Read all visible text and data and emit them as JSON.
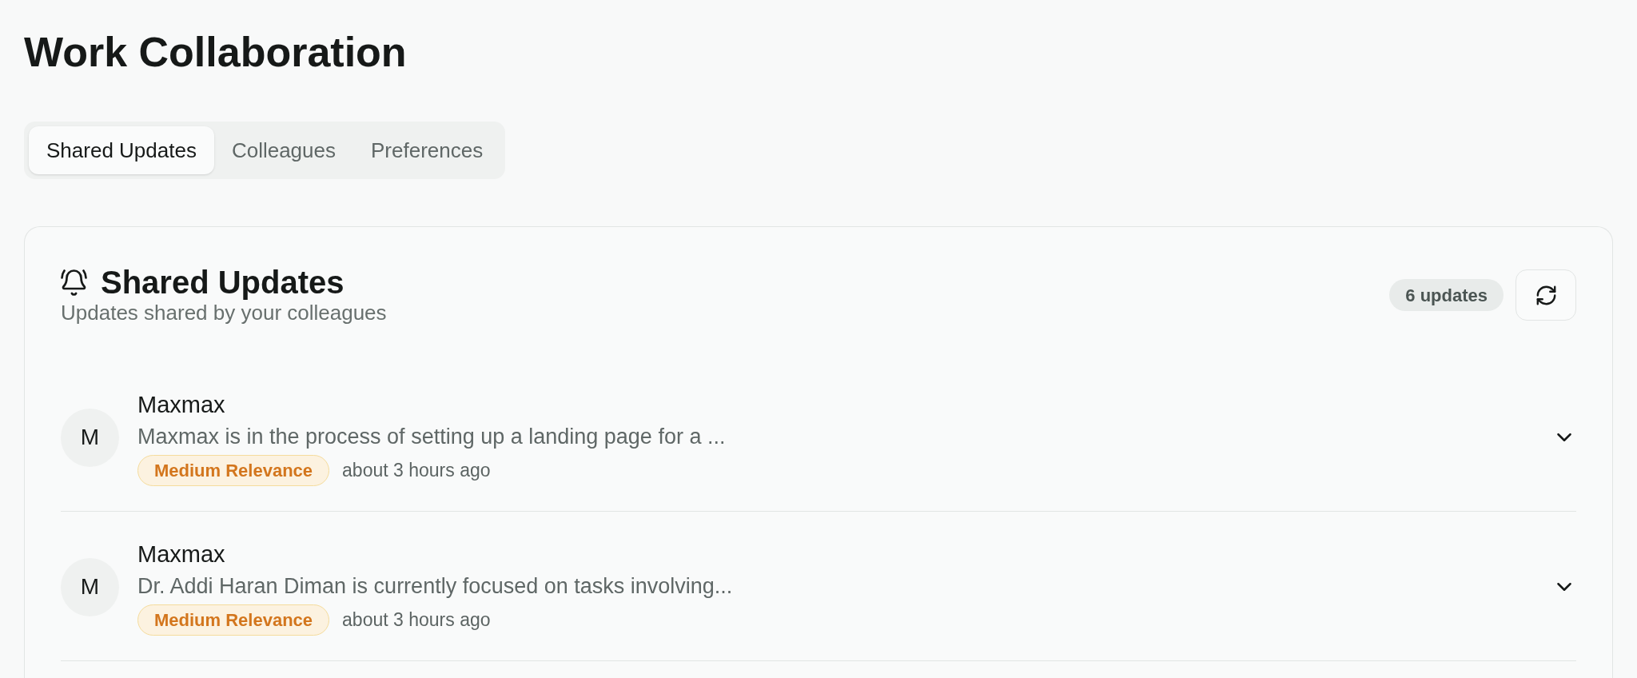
{
  "page": {
    "title": "Work Collaboration"
  },
  "tabs": [
    {
      "label": "Shared Updates",
      "selected": true
    },
    {
      "label": "Colleagues",
      "selected": false
    },
    {
      "label": "Preferences",
      "selected": false
    }
  ],
  "panel": {
    "title": "Shared Updates",
    "subtitle": "Updates shared by your colleagues",
    "count": "6 updates"
  },
  "updates": [
    {
      "avatar": "M",
      "author": "Maxmax",
      "summary": "Maxmax is in the process of setting up a landing page for a ...",
      "relevance": "Medium Relevance",
      "time": "about 3 hours ago",
      "expanded": false
    },
    {
      "avatar": "M",
      "author": "Maxmax",
      "summary": "Dr. Addi Haran Diman is currently focused on tasks involving...",
      "relevance": "Medium Relevance",
      "time": "about 3 hours ago",
      "expanded": false
    }
  ]
}
